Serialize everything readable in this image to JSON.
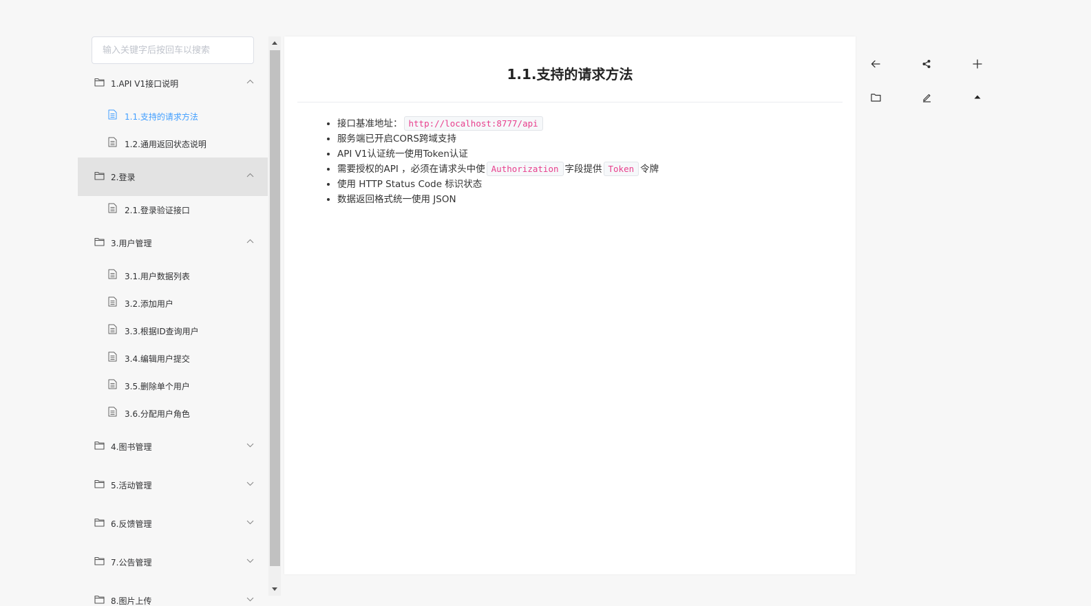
{
  "search": {
    "placeholder": "输入关键字后按回车以搜索"
  },
  "sidebar": {
    "groups": [
      {
        "label": "1.API V1接口说明",
        "expanded": true,
        "active": false,
        "items": [
          {
            "label": "1.1.支持的请求方法",
            "active": true
          },
          {
            "label": "1.2.通用返回状态说明",
            "active": false
          }
        ]
      },
      {
        "label": "2.登录",
        "expanded": true,
        "active": true,
        "items": [
          {
            "label": "2.1.登录验证接口",
            "active": false
          }
        ]
      },
      {
        "label": "3.用户管理",
        "expanded": true,
        "active": false,
        "items": [
          {
            "label": "3.1.用户数据列表",
            "active": false
          },
          {
            "label": "3.2.添加用户",
            "active": false
          },
          {
            "label": "3.3.根据ID查询用户",
            "active": false
          },
          {
            "label": "3.4.编辑用户提交",
            "active": false
          },
          {
            "label": "3.5.删除单个用户",
            "active": false
          },
          {
            "label": "3.6.分配用户角色",
            "active": false
          }
        ]
      },
      {
        "label": "4.图书管理",
        "expanded": false,
        "active": false,
        "items": []
      },
      {
        "label": "5.活动管理",
        "expanded": false,
        "active": false,
        "items": []
      },
      {
        "label": "6.反馈管理",
        "expanded": false,
        "active": false,
        "items": []
      },
      {
        "label": "7.公告管理",
        "expanded": false,
        "active": false,
        "items": []
      },
      {
        "label": "8.图片上传",
        "expanded": false,
        "active": false,
        "items": []
      }
    ]
  },
  "main": {
    "title": "1.1.支持的请求方法",
    "bullets": {
      "b1_text": "接口基准地址：",
      "b1_code": "http://localhost:8777/api",
      "b2_text": "服务端已开启CORS跨域支持",
      "b3_text": "API V1认证统一使用Token认证",
      "b4_pre": "需要授权的API ，必须在请求头中使",
      "b4_code1": "Authorization",
      "b4_mid": "字段提供",
      "b4_code2": "Token",
      "b4_post": "令牌",
      "b5_text": "使用 HTTP Status Code 标识状态",
      "b6_text": "数据返回格式统一使用 JSON"
    }
  },
  "tools": {
    "icons": [
      "back-arrow-icon",
      "share-icon",
      "plus-icon",
      "folder-icon",
      "edit-icon",
      "caret-up-icon"
    ]
  },
  "colors": {
    "accent": "#409eff",
    "code": "#e83e8c",
    "active_bg": "#e3e3e3"
  }
}
